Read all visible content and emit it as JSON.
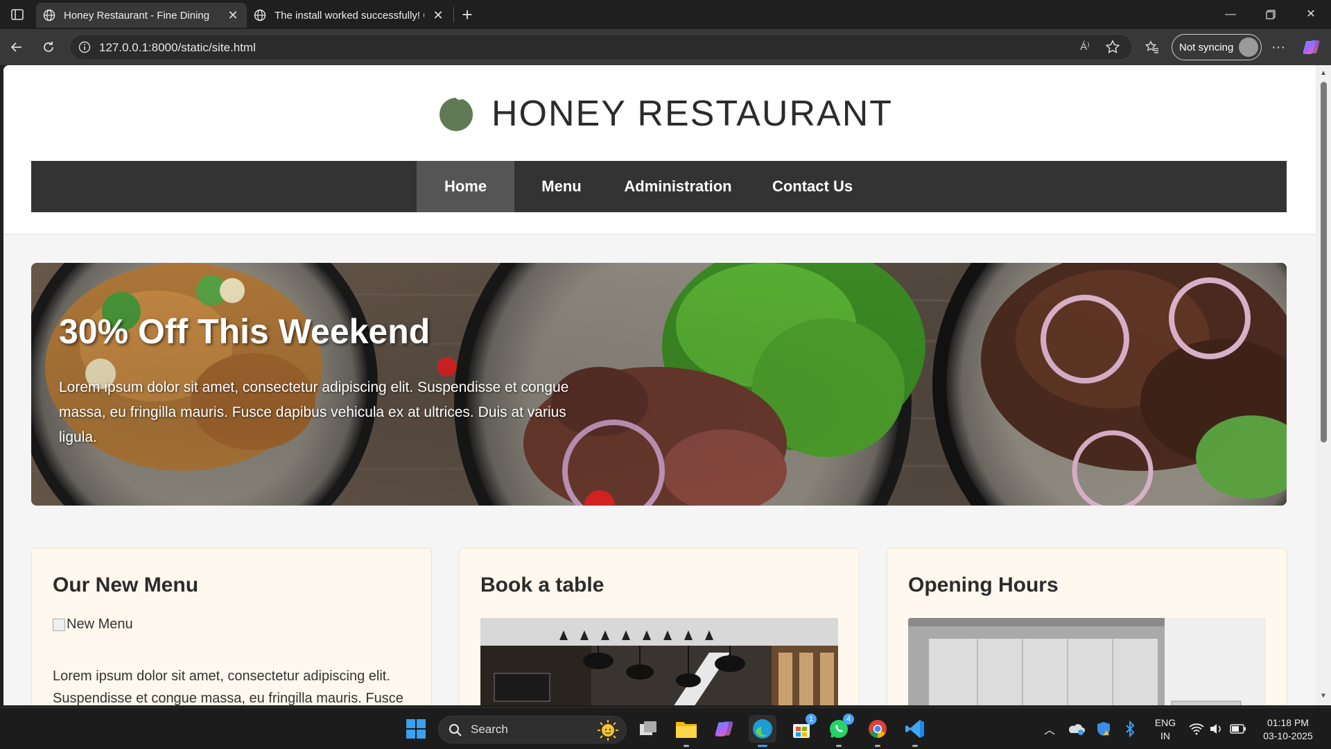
{
  "browser": {
    "tabs": [
      {
        "title": "Honey Restaurant - Fine Dining",
        "active": true
      },
      {
        "title": "The install worked successfully! Co",
        "active": false
      }
    ],
    "url": "127.0.0.1:8000/static/site.html",
    "read_aloud_label": "Á⁾",
    "sync_label": "Not syncing"
  },
  "site": {
    "brand": "HONEY RESTAURANT",
    "brand_color": "#5f7a54",
    "nav": [
      {
        "label": "Home",
        "active": true
      },
      {
        "label": "Menu",
        "active": false
      },
      {
        "label": "Administration",
        "active": false
      },
      {
        "label": "Contact Us",
        "active": false
      }
    ],
    "hero": {
      "title": "30% Off This Weekend",
      "text": "Lorem ipsum dolor sit amet, consectetur adipiscing elit. Suspendisse et congue massa, eu fringilla mauris. Fusce dapibus vehicula ex at ultrices. Duis at varius ligula."
    },
    "cards": [
      {
        "title": "Our New Menu",
        "image_alt": "New Menu",
        "text": "Lorem ipsum dolor sit amet, consectetur adipiscing elit. Suspendisse et congue massa, eu fringilla mauris. Fusce"
      },
      {
        "title": "Book a table"
      },
      {
        "title": "Opening Hours"
      }
    ]
  },
  "taskbar": {
    "search_label": "Search",
    "language": "ENG",
    "region": "IN",
    "time": "01:18 PM",
    "date": "03-10-2025",
    "store_badge": "1",
    "whatsapp_badge": "4"
  }
}
